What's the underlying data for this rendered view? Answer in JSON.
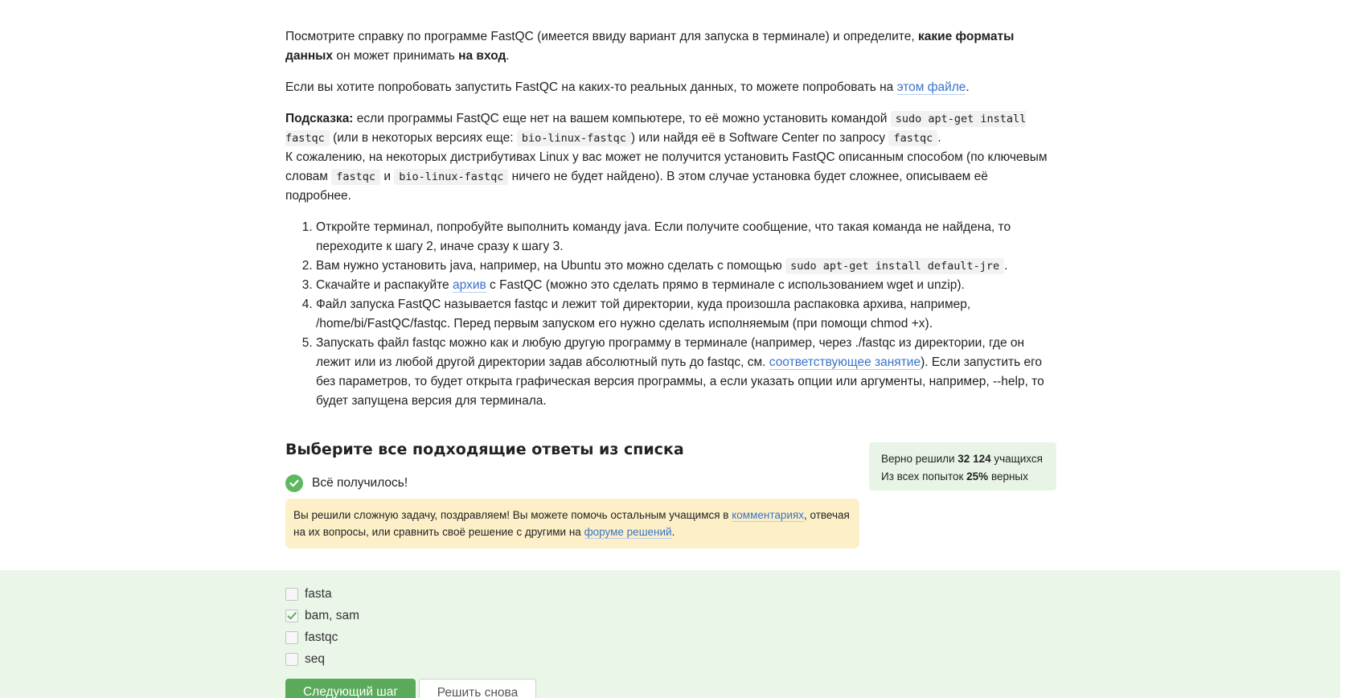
{
  "task": {
    "p1": {
      "text_before": "Посмотрите справку по программе FastQC (имеется ввиду вариант для запуска в терминале) и определите, ",
      "bold1": "какие форматы данных",
      "text_mid": " он может принимать ",
      "bold2": "на вход",
      "text_end": "."
    },
    "p2": {
      "text_before": "Если вы хотите попробовать запустить FastQC на каких-то реальных данных, то можете попробовать на ",
      "link": "этом файле",
      "text_end": "."
    },
    "hint": {
      "label": "Подсказка:",
      "t1": " если программы FastQC еще нет на вашем компьютере, то её можно установить командой ",
      "code1": "sudo apt-get install fastqc",
      "t2": " (или в некоторых версиях еще: ",
      "code2": "bio-linux-fastqc",
      "t3": ") или найдя её в Software Center по запросу ",
      "code3": "fastqc",
      "t4": ".",
      "t5": "К сожалению, на некоторых дистрибутивах Linux у вас может не получится установить FastQC описанным способом (по ключевым словам ",
      "code4": "fastqc",
      "t6": " и ",
      "code5": "bio-linux-fastqc",
      "t7": " ничего не будет найдено). В этом случае установка будет сложнее, описываем её подробнее."
    },
    "steps": {
      "s1": "Откройте терминал, попробуйте выполнить команду java. Если получите сообщение, что такая команда не найдена, то переходите к шагу 2, иначе сразу к шагу 3.",
      "s2_before": "Вам нужно установить java, например, на Ubuntu это можно сделать с помощью ",
      "s2_code": "sudo apt-get install default-jre",
      "s2_after": ".",
      "s3_before": "Скачайте и распакуйте ",
      "s3_link": "архив",
      "s3_after": " с FastQC (можно это сделать прямо в терминале с использованием wget и unzip).",
      "s4": "Файл запуска FastQC называется fastqc и лежит той директории, куда произошла распаковка архива, например, /home/bi/FastQC/fastqc. Перед первым запуском его нужно сделать исполняемым (при помощи chmod +x).",
      "s5_before": "Запускать файл fastqc можно как и любую другую программу в терминале (например, через ./fastqc из директории, где он лежит или из любой другой директории задав абсолютный путь до fastqc, см. ",
      "s5_link": "соответствующее занятие",
      "s5_after": "). Если запустить его без параметров, то будет открыта графическая версия программы, а если указать опции или аргументы, например, --help, то будет запущена версия для терминала."
    }
  },
  "quiz": {
    "title": "Выберите все подходящие ответы из списка",
    "success": "Всё получилось!",
    "notice": {
      "t1": "Вы решили сложную задачу, поздравляем! Вы можете помочь остальным учащимся в ",
      "link1": "комментариях",
      "t2": ", отвечая на их вопросы, или сравнить своё решение с другими на ",
      "link2": "форуме решений",
      "t3": "."
    },
    "stats": {
      "line1_before": "Верно решили ",
      "line1_bold": "32 124",
      "line1_after": " учащихся",
      "line2_before": "Из всех попыток ",
      "line2_bold": "25%",
      "line2_after": " верных"
    },
    "options": [
      {
        "label": "fasta",
        "checked": false
      },
      {
        "label": "bam, sam",
        "checked": true
      },
      {
        "label": "fastqc",
        "checked": false
      },
      {
        "label": "seq",
        "checked": false
      }
    ],
    "next_button": "Следующий шаг",
    "retry_button": "Решить снова"
  },
  "colors": {
    "accent_green": "#5aaa5a",
    "link_blue": "#3a73c9",
    "notice_bg": "#fdf0c8",
    "answers_bg": "#eaf6e8"
  }
}
